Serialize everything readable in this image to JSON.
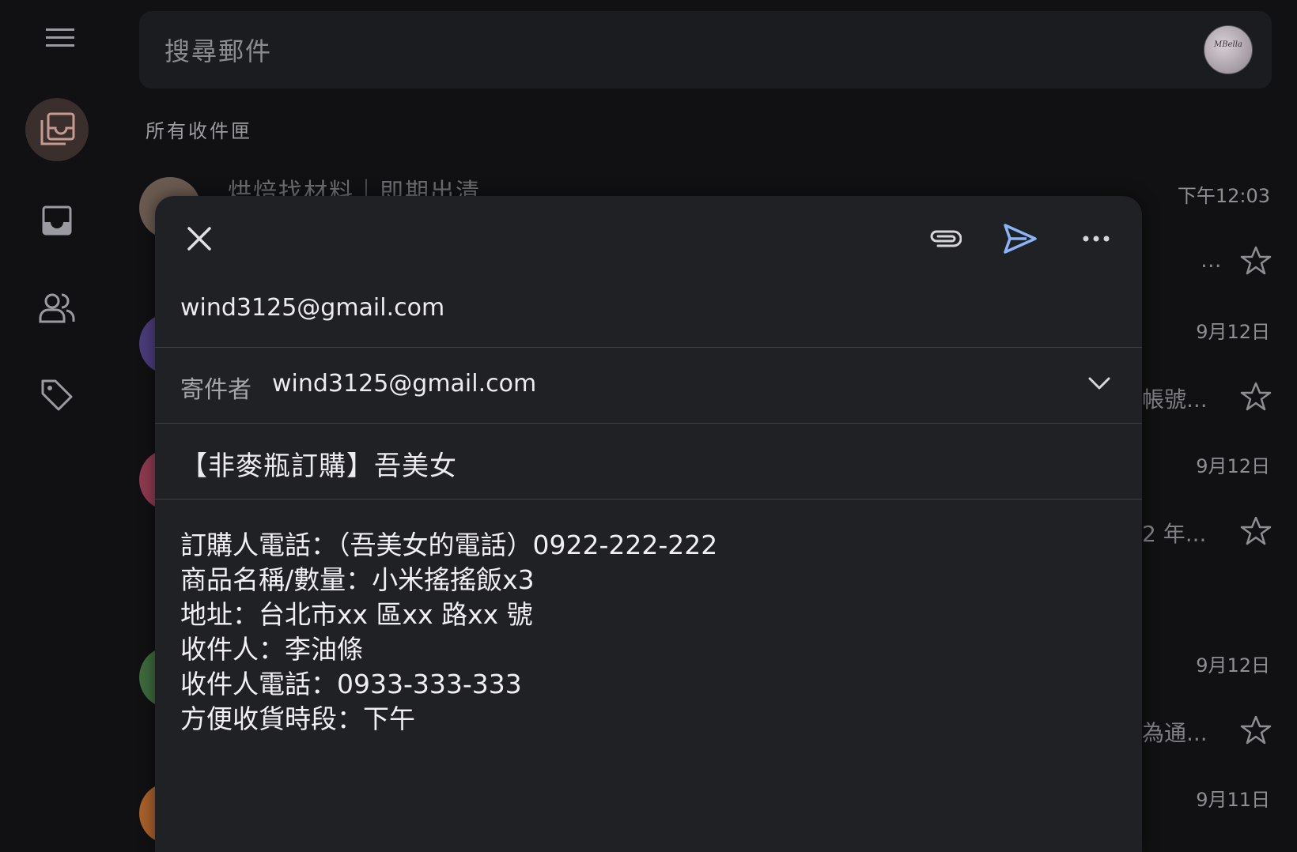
{
  "search": {
    "placeholder": "搜尋郵件"
  },
  "account": {
    "avatar_text": "MBella"
  },
  "sidebar": {
    "items": [
      {
        "name": "menu"
      },
      {
        "name": "all-inboxes",
        "active": true
      },
      {
        "name": "inbox"
      },
      {
        "name": "contacts"
      },
      {
        "name": "labels"
      }
    ]
  },
  "list": {
    "title": "所有收件匣",
    "rows": [
      {
        "subject": "烘焙找材料｜即期出清",
        "time": "下午12:03",
        "snippet": "...",
        "avatar_color": "#6b5a50"
      },
      {
        "time": "9月12日",
        "snippet": "帳號...",
        "avatar_color": "#4b3c7a"
      },
      {
        "time": "9月12日",
        "snippet": "2 年...",
        "avatar_color": "#8e3a50"
      },
      {
        "time": "9月12日",
        "snippet": "為通...",
        "avatar_color": "#3d6a3c"
      },
      {
        "time": "9月11日",
        "snippet": "",
        "avatar_color": "#a8612a"
      }
    ]
  },
  "compose": {
    "to": "wind3125@gmail.com",
    "from_label": "寄件者",
    "from_value": "wind3125@gmail.com",
    "subject": "【非麥瓶訂購】吾美女",
    "body": [
      "訂購人電話：（吾美女的電話）0922-222-222",
      "商品名稱/數量：小米搖搖飯x3",
      "地址：台北市xx 區xx 路xx 號",
      "收件人：李油條",
      "收件人電話：0933-333-333",
      "方便收貨時段：下午"
    ],
    "send_color": "#8ab4f8"
  }
}
